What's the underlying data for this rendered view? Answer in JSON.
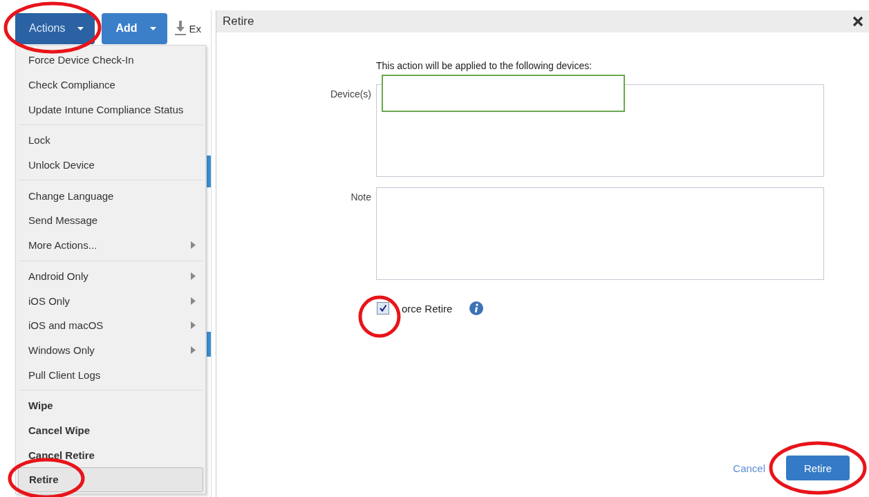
{
  "toolbar": {
    "buttons": [
      {
        "label": "Actions",
        "selected": true
      },
      {
        "label": "Add",
        "selected": false
      }
    ],
    "export_label": "Ex"
  },
  "actions_menu": {
    "groups": [
      {
        "items": [
          {
            "label": "Force Device Check-In",
            "kind": "item",
            "bold": false,
            "selected": false
          },
          {
            "label": "Check Compliance",
            "kind": "item",
            "bold": false,
            "selected": false
          },
          {
            "label": "Update Intune Compliance Status",
            "kind": "item",
            "bold": false,
            "selected": false
          }
        ]
      },
      {
        "items": [
          {
            "label": "Lock",
            "kind": "item",
            "bold": false,
            "selected": false
          },
          {
            "label": "Unlock Device",
            "kind": "item",
            "bold": false,
            "selected": false
          }
        ]
      },
      {
        "items": [
          {
            "label": "Change Language",
            "kind": "item",
            "bold": false,
            "selected": false
          },
          {
            "label": "Send Message",
            "kind": "item",
            "bold": false,
            "selected": false
          },
          {
            "label": "More Actions...",
            "kind": "submenu",
            "bold": false,
            "selected": false
          }
        ]
      },
      {
        "items": [
          {
            "label": "Android Only",
            "kind": "submenu",
            "bold": false,
            "selected": false
          },
          {
            "label": "iOS Only",
            "kind": "submenu",
            "bold": false,
            "selected": false
          },
          {
            "label": "iOS and macOS",
            "kind": "submenu",
            "bold": false,
            "selected": false
          },
          {
            "label": "Windows Only",
            "kind": "submenu",
            "bold": false,
            "selected": false
          },
          {
            "label": "Pull Client Logs",
            "kind": "item",
            "bold": false,
            "selected": false
          }
        ]
      },
      {
        "items": [
          {
            "label": "Wipe",
            "kind": "item",
            "bold": true,
            "selected": false
          },
          {
            "label": "Cancel Wipe",
            "kind": "item",
            "bold": true,
            "selected": false
          },
          {
            "label": "Cancel Retire",
            "kind": "item",
            "bold": true,
            "selected": false
          },
          {
            "label": "Retire",
            "kind": "item",
            "bold": true,
            "selected": true
          }
        ]
      }
    ]
  },
  "dialog": {
    "title": "Retire",
    "intro": "This action will be applied to the following devices:",
    "fields": [
      {
        "label": "Device(s)",
        "redacted": true
      },
      {
        "label": "Note",
        "redacted": false
      }
    ],
    "force_retire": {
      "label": "orce Retire",
      "checked": true
    },
    "cancel": "Cancel",
    "submit": "Retire"
  }
}
